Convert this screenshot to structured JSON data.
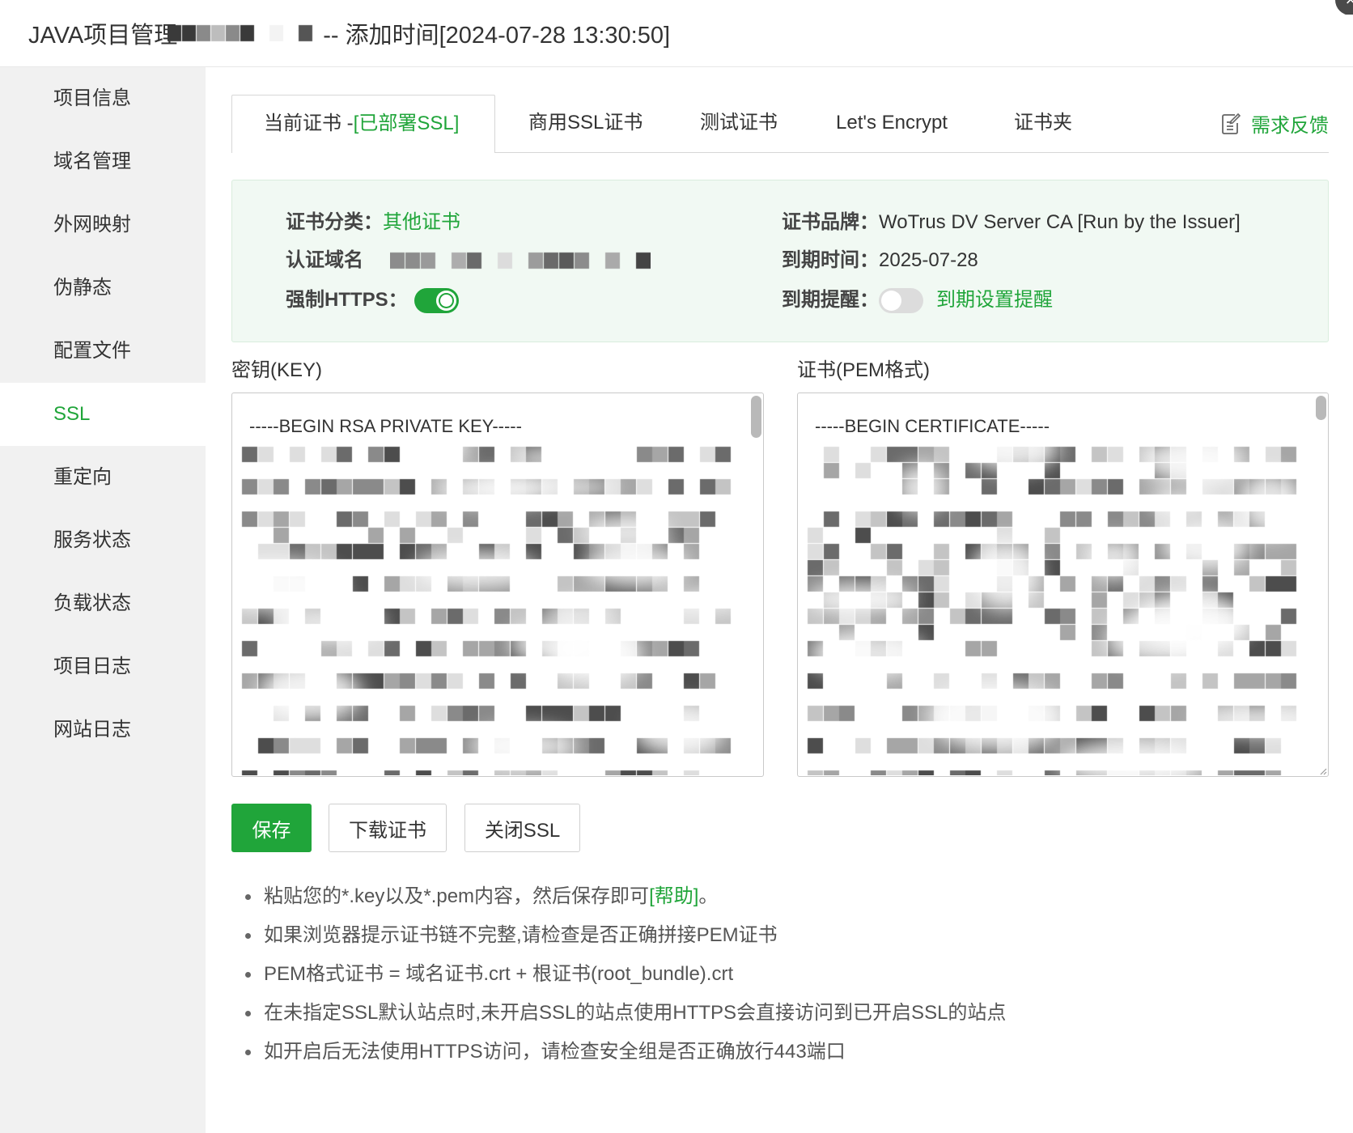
{
  "window": {
    "title_prefix": "JAVA项目管理",
    "title_suffix": "-- 添加时间[2024-07-28 13:30:50]",
    "close_icon": "close-icon",
    "close_glyph": "×"
  },
  "sidebar": {
    "items": [
      {
        "label": "项目信息"
      },
      {
        "label": "域名管理"
      },
      {
        "label": "外网映射"
      },
      {
        "label": "伪静态"
      },
      {
        "label": "配置文件"
      },
      {
        "label": "SSL",
        "active": true
      },
      {
        "label": "重定向"
      },
      {
        "label": "服务状态"
      },
      {
        "label": "负载状态"
      },
      {
        "label": "项目日志"
      },
      {
        "label": "网站日志"
      }
    ]
  },
  "tabs": [
    {
      "label": "当前证书 -",
      "status": "[已部署SSL]",
      "active": true
    },
    {
      "label": "商用SSL证书"
    },
    {
      "label": "测试证书"
    },
    {
      "label": "Let's Encrypt"
    },
    {
      "label": "证书夹"
    }
  ],
  "feedback": {
    "label": "需求反馈",
    "icon": "edit-icon"
  },
  "certificate_info": {
    "category": {
      "label": "证书分类：",
      "value": "其他证书"
    },
    "domain": {
      "label": "认证域名"
    },
    "force_https": {
      "label": "强制HTTPS：",
      "enabled": true
    },
    "brand": {
      "label": "证书品牌：",
      "value": "WoTrus DV Server CA [Run by the Issuer]"
    },
    "expiry": {
      "label": "到期时间：",
      "value": "2025-07-28"
    },
    "reminder": {
      "label": "到期提醒：",
      "enabled": false,
      "link": "到期设置提醒"
    }
  },
  "key_editor": {
    "label": "密钥(KEY)",
    "content": "-----BEGIN RSA PRIVATE KEY-----"
  },
  "cert_editor": {
    "label": "证书(PEM格式)",
    "content": "-----BEGIN CERTIFICATE-----"
  },
  "actions": {
    "save": "保存",
    "download": "下载证书",
    "close_ssl": "关闭SSL"
  },
  "tips": [
    {
      "text": "粘贴您的*.key以及*.pem内容，然后保存即可",
      "link": "[帮助]",
      "tail": "。"
    },
    {
      "text": "如果浏览器提示证书链不完整,请检查是否正确拼接PEM证书"
    },
    {
      "text": "PEM格式证书 = 域名证书.crt + 根证书(root_bundle).crt"
    },
    {
      "text": "在未指定SSL默认站点时,未开启SSL的站点使用HTTPS会直接访问到已开启SSL的站点"
    },
    {
      "text": "如开启后无法使用HTTPS访问，请检查安全组是否正确放行443端口"
    }
  ],
  "colors": {
    "accent": "#20a53a",
    "sidebar_bg": "#f1f1f1",
    "info_bg": "#f1f9f3",
    "info_border": "#d9eddd"
  }
}
